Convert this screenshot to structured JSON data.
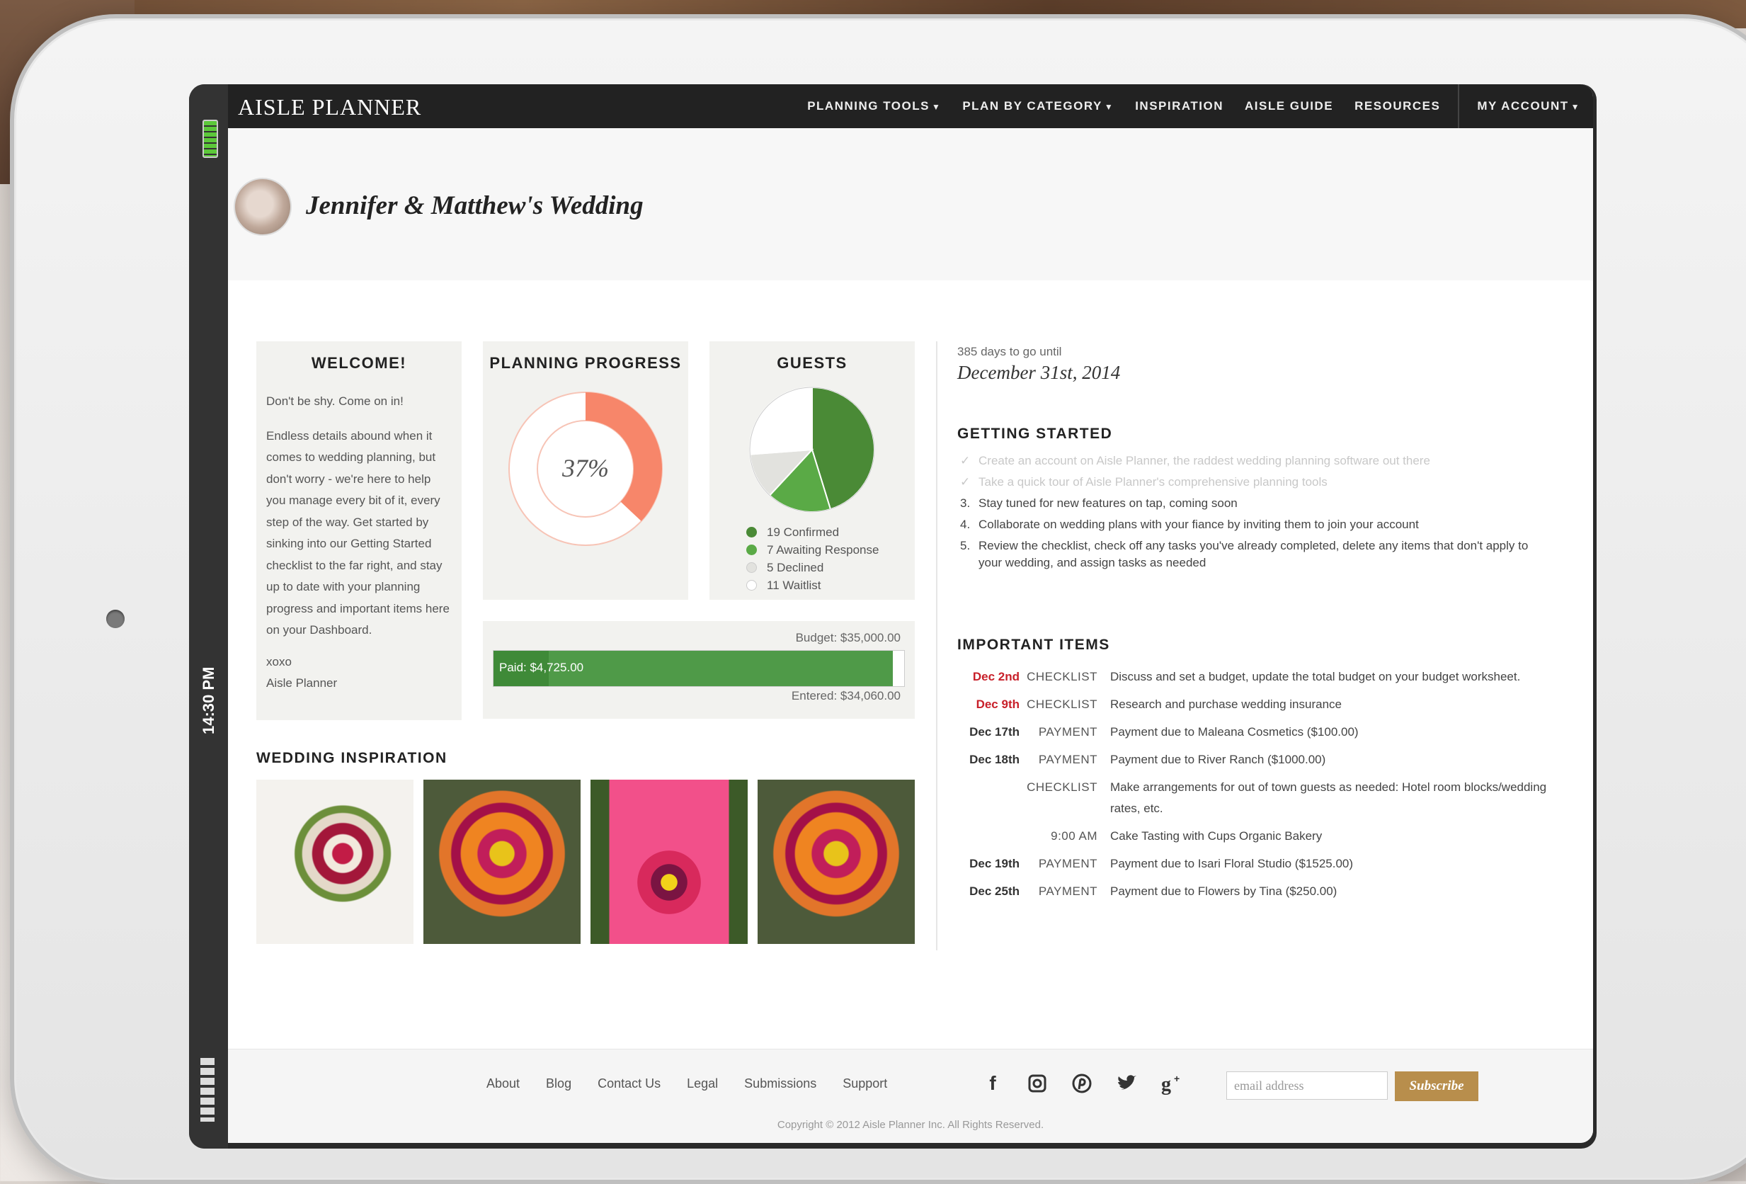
{
  "app": {
    "logo": "AISLE PLANNER",
    "nav": {
      "planning_tools": "PLANNING TOOLS",
      "plan_by_category": "PLAN BY CATEGORY",
      "inspiration": "INSPIRATION",
      "aisle_guide": "AISLE GUIDE",
      "resources": "RESOURCES",
      "my_account": "MY ACCOUNT"
    }
  },
  "device": {
    "time": "14:30 PM"
  },
  "header": {
    "title": "Jennifer & Matthew's Wedding"
  },
  "welcome": {
    "title": "WELCOME!",
    "intro": "Don't be shy. Come on in!",
    "body": "Endless details abound when it comes to wedding planning, but don't worry - we're here to help you manage every bit of it, every step of the way. Get started by sinking into our Getting Started checklist to the far right, and stay up to date with your planning progress and important items here on your Dashboard.",
    "signoff_1": "xoxo",
    "signoff_2": "Aisle Planner"
  },
  "progress": {
    "title": "PLANNING PROGRESS",
    "percent_label": "37%",
    "percent": 37,
    "accent_color": "#f7866a"
  },
  "guests": {
    "title": "GUESTS",
    "segments": [
      {
        "label": "19 Confirmed",
        "value": 19,
        "color": "#4a8a36"
      },
      {
        "label": "7 Awaiting Response",
        "value": 7,
        "color": "#5aaa46"
      },
      {
        "label": "5 Declined",
        "value": 5,
        "color": "#e2e2de"
      },
      {
        "label": "11 Waitlist",
        "value": 11,
        "color": "#ffffff"
      }
    ]
  },
  "budget": {
    "budget_label": "Budget: $35,000.00",
    "paid_label": "Paid: $4,725.00",
    "entered_label": "Entered: $34,060.00",
    "budget": 35000,
    "paid": 4725,
    "entered": 34060
  },
  "inspiration": {
    "title": "WEDDING INSPIRATION"
  },
  "countdown": {
    "days_text": "385 days to go until",
    "date": "December 31st, 2014"
  },
  "getting_started": {
    "title": "GETTING STARTED",
    "items": [
      {
        "marker": "✓",
        "text": "Create an account on Aisle Planner, the raddest wedding planning software out there",
        "done": true
      },
      {
        "marker": "✓",
        "text": "Take a quick tour of Aisle Planner's comprehensive planning tools",
        "done": true
      },
      {
        "marker": "3.",
        "text": "Stay tuned for new features on tap, coming soon",
        "done": false
      },
      {
        "marker": "4.",
        "text": "Collaborate on wedding plans with your fiance by inviting them to join your account",
        "done": false
      },
      {
        "marker": "5.",
        "text": "Review the checklist, check off any tasks you've already completed, delete any items that don't apply to your wedding, and assign tasks as needed",
        "done": false
      }
    ]
  },
  "important_items": {
    "title": "IMPORTANT ITEMS",
    "rows": [
      {
        "date": "Dec 2nd",
        "type": "CHECKLIST",
        "desc": "Discuss and set a budget, update the total budget on your budget worksheet.",
        "urgent": true
      },
      {
        "date": "Dec 9th",
        "type": "CHECKLIST",
        "desc": "Research and purchase wedding insurance",
        "urgent": true
      },
      {
        "date": "Dec 17th",
        "type": "PAYMENT",
        "desc": "Payment due to Maleana Cosmetics ($100.00)",
        "urgent": false
      },
      {
        "date": "Dec 18th",
        "type": "PAYMENT",
        "desc": "Payment due to River Ranch ($1000.00)",
        "urgent": false
      },
      {
        "date": "",
        "type": "CHECKLIST",
        "desc": "Make arrangements for out of town guests as needed: Hotel room blocks/wedding rates, etc.",
        "urgent": false
      },
      {
        "date": "",
        "type": "9:00 AM",
        "desc": "Cake Tasting with Cups Organic Bakery",
        "urgent": false
      },
      {
        "date": "Dec 19th",
        "type": "PAYMENT",
        "desc": "Payment due to Isari Floral Studio ($1525.00)",
        "urgent": false
      },
      {
        "date": "Dec 25th",
        "type": "PAYMENT",
        "desc": "Payment due to Flowers by Tina ($250.00)",
        "urgent": false
      }
    ]
  },
  "footer": {
    "links": [
      "About",
      "Blog",
      "Contact Us",
      "Legal",
      "Submissions",
      "Support"
    ],
    "email_placeholder": "email address",
    "subscribe_label": "Subscribe",
    "copyright": "Copyright © 2012 Aisle Planner Inc. All Rights Reserved."
  }
}
